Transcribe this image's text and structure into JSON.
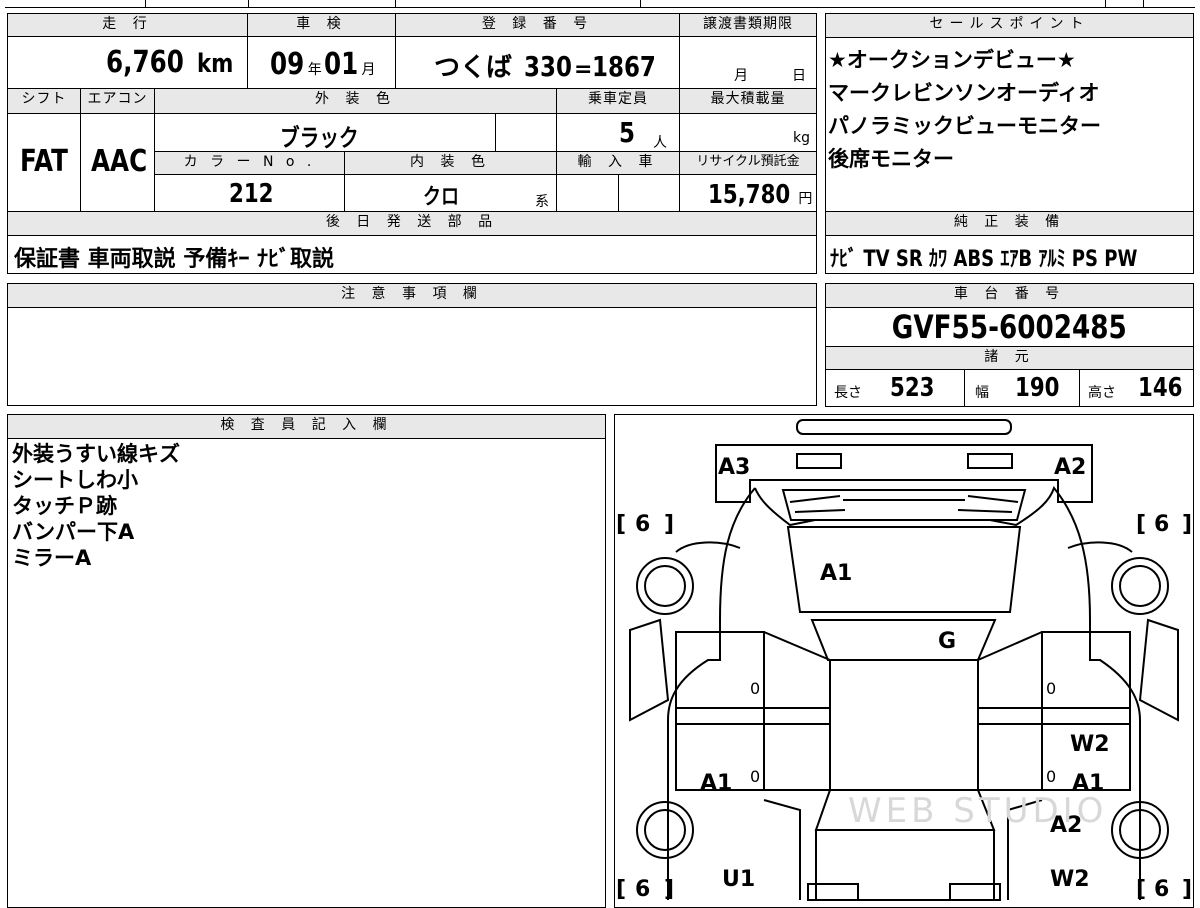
{
  "vehicle": {
    "mileage_header": "走 行",
    "mileage_value": "6,760",
    "mileage_unit": "km",
    "shaken_header": "車 検",
    "shaken_year": "09",
    "shaken_year_unit": "年",
    "shaken_month": "01",
    "shaken_month_unit": "月",
    "registration_header": "登 録 番 号",
    "registration_area": "つくば",
    "registration_class": "330",
    "registration_kana": "=",
    "registration_number": "1867",
    "transfer_deadline_header": "譲渡書類期限",
    "transfer_month_unit": "月",
    "transfer_day_unit": "日",
    "shift_header": "シフト",
    "shift_value": "FAT",
    "aircon_header": "エアコン",
    "aircon_value": "AAC",
    "exterior_color_header": "外 装 色",
    "exterior_color_value": "ブラック",
    "capacity_header": "乗車定員",
    "capacity_value": "5",
    "capacity_unit": "人",
    "max_load_header": "最大積載量",
    "max_load_unit": "kg",
    "color_no_header": "カ ラ ー N o .",
    "color_no_value": "212",
    "interior_color_header": "内 装 色",
    "interior_color_value": "クロ",
    "interior_color_suffix": "系",
    "import_header": "輸 入 車",
    "recycle_header": "リサイクル預託金",
    "recycle_value": "15,780",
    "recycle_unit": "円"
  },
  "sales_points": {
    "header": "セールスポイント",
    "items": [
      "★オークションデビュー★",
      "マークレビンソンオーディオ",
      "パノラミックビューモニター",
      "後席モニター"
    ]
  },
  "parts": {
    "header": "後 日 発 送 部 品",
    "value": "保証書 車両取説 予備ｷｰ ﾅﾋﾞ取説"
  },
  "equipment": {
    "header": "純 正 装 備",
    "value": "ﾅﾋﾞ TV SR ｶﾜ ABS ｴｱB ｱﾙﾐ PS PW"
  },
  "notes_field": {
    "header": "注 意 事 項 欄"
  },
  "chassis": {
    "header": "車 台 番 号",
    "value": "GVF55-6002485",
    "specs_header": "諸 元",
    "length_label": "長さ",
    "length_value": "523",
    "width_label": "幅",
    "width_value": "190",
    "height_label": "高さ",
    "height_value": "146"
  },
  "inspector": {
    "header": "検 査 員 記 入 欄",
    "notes": [
      "外装うすい線キズ",
      "シートしわ小",
      "タッチＰ跡",
      "バンパー下A",
      "ミラーA"
    ]
  },
  "diagram": {
    "watermark": "WEB STUDIO",
    "tire_tread": "6",
    "marks": {
      "a3": "A3",
      "a2_front": "A2",
      "a1_hood": "A1",
      "g_windshield": "G",
      "zero_left_front": "0",
      "zero_right_front": "0",
      "w2_right_door": "W2",
      "a1_left_rear": "A1",
      "zero_left_rear": "0",
      "zero_right_rear": "0",
      "a1_right_rear": "A1",
      "a2_right_quarter": "A2",
      "u1_left_quarter": "U1",
      "w2_right_quarter": "W2"
    }
  }
}
